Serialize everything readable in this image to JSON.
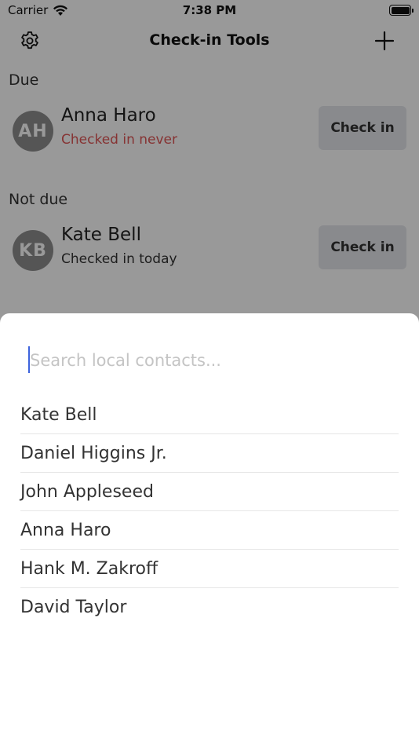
{
  "status_bar": {
    "carrier": "Carrier",
    "time": "7:38 PM"
  },
  "nav": {
    "title": "Check-in Tools",
    "left_icon": "gear-icon",
    "right_icon": "plus-icon"
  },
  "sections": [
    {
      "header": "Due",
      "contacts": [
        {
          "initials": "AH",
          "name": "Anna Haro",
          "status": "Checked in never",
          "button": "Check in"
        }
      ]
    },
    {
      "header": "Not due",
      "contacts": [
        {
          "initials": "KB",
          "name": "Kate Bell",
          "status": "Checked in today",
          "button": "Check in"
        }
      ]
    }
  ],
  "sheet": {
    "search_placeholder": "Search local contacts...",
    "search_value": "",
    "contacts": [
      "Kate Bell",
      "Daniel Higgins Jr.",
      "John Appleseed",
      "Anna Haro",
      "Hank M. Zakroff",
      "David Taylor"
    ]
  },
  "colors": {
    "due_status": "#e05555",
    "caret": "#3d63dd",
    "avatar": "#8e8e8e",
    "button_bg": "#e4e7ec"
  }
}
